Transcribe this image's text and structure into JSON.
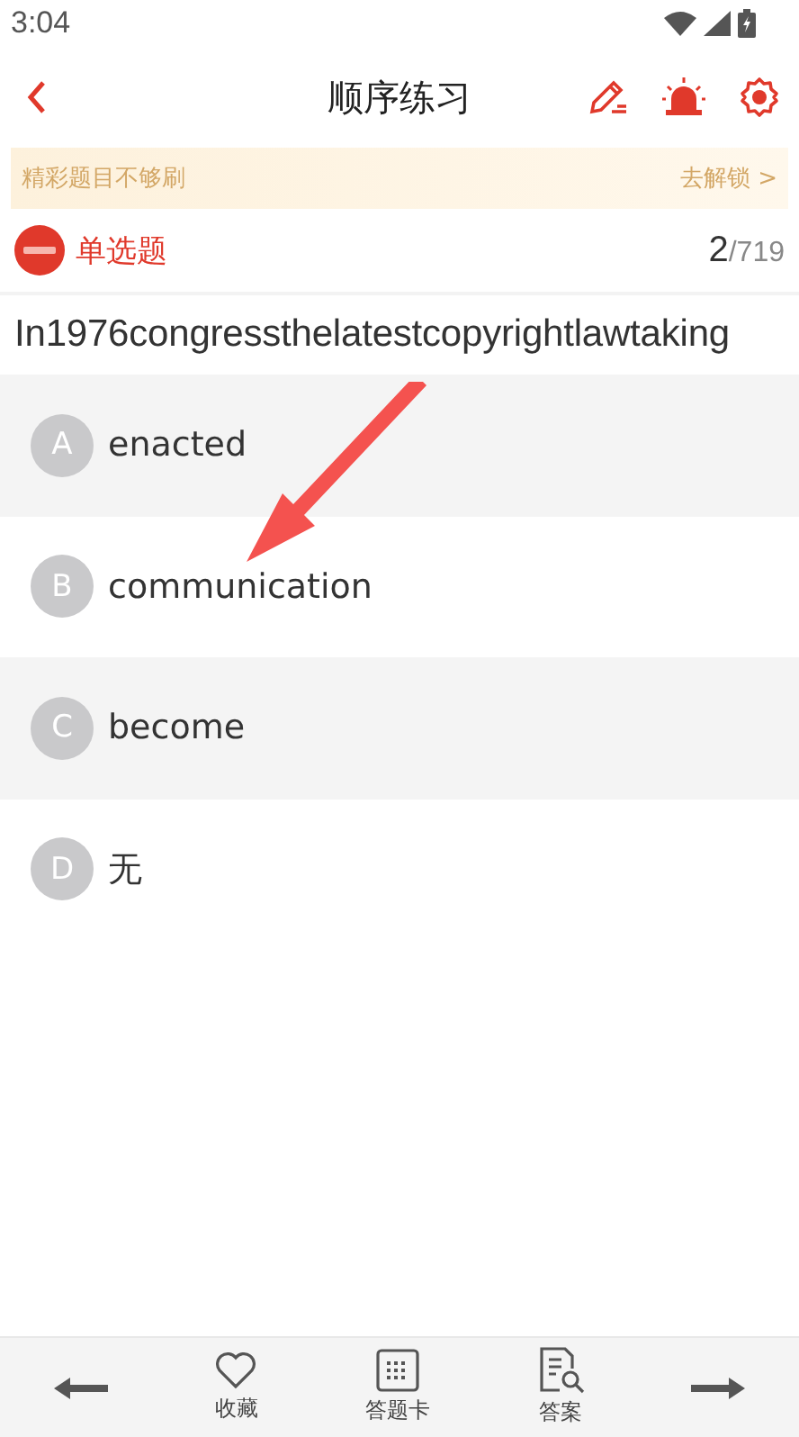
{
  "status_bar": {
    "time": "3:04"
  },
  "header": {
    "title": "顺序练习"
  },
  "banner": {
    "text": "精彩题目不够刷",
    "action": "去解锁 >"
  },
  "question": {
    "type": "单选题",
    "current": "2",
    "total": "/719",
    "text": "In1976congressthelatestcopyrightlawtaking"
  },
  "options": [
    {
      "letter": "A",
      "text": "enacted"
    },
    {
      "letter": "B",
      "text": "communication"
    },
    {
      "letter": "C",
      "text": "become"
    },
    {
      "letter": "D",
      "text": "无"
    }
  ],
  "bottom_bar": [
    {
      "kind": "prev"
    },
    {
      "kind": "favorite",
      "label": "收藏"
    },
    {
      "kind": "card",
      "label": "答题卡"
    },
    {
      "kind": "answer",
      "label": "答案"
    },
    {
      "kind": "next"
    }
  ]
}
